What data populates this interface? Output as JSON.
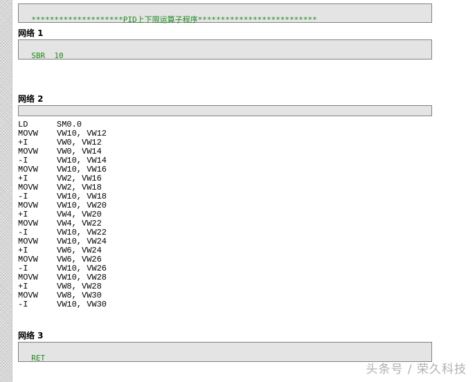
{
  "header_comment": "********************PID上下限运算子程序**************************",
  "networks": [
    {
      "title": "网络 1",
      "comment": "SBR  10"
    },
    {
      "title": "网络 2",
      "comment": ""
    },
    {
      "title": "网络 3",
      "comment": "RET"
    }
  ],
  "code": [
    {
      "op": "LD",
      "args": "SM0.0"
    },
    {
      "op": "MOVW",
      "args": "VW10, VW12"
    },
    {
      "op": "+I",
      "args": "VW0, VW12"
    },
    {
      "op": "MOVW",
      "args": "VW0, VW14"
    },
    {
      "op": "-I",
      "args": "VW10, VW14"
    },
    {
      "op": "MOVW",
      "args": "VW10, VW16"
    },
    {
      "op": "+I",
      "args": "VW2, VW16"
    },
    {
      "op": "MOVW",
      "args": "VW2, VW18"
    },
    {
      "op": "-I",
      "args": "VW10, VW18"
    },
    {
      "op": "MOVW",
      "args": "VW10, VW20"
    },
    {
      "op": "+I",
      "args": "VW4, VW20"
    },
    {
      "op": "MOVW",
      "args": "VW4, VW22"
    },
    {
      "op": "-I",
      "args": "VW10, VW22"
    },
    {
      "op": "MOVW",
      "args": "VW10, VW24"
    },
    {
      "op": "+I",
      "args": "VW6, VW24"
    },
    {
      "op": "MOVW",
      "args": "VW6, VW26"
    },
    {
      "op": "-I",
      "args": "VW10, VW26"
    },
    {
      "op": "MOVW",
      "args": "VW10, VW28"
    },
    {
      "op": "+I",
      "args": "VW8, VW28"
    },
    {
      "op": "MOVW",
      "args": "VW8, VW30"
    },
    {
      "op": "-I",
      "args": "VW10, VW30"
    }
  ],
  "watermark": "头条号 / 荣久科技",
  "colors": {
    "comment_text": "#1e8a1e",
    "comment_bg": "#e4e4e4",
    "border": "#808080"
  }
}
